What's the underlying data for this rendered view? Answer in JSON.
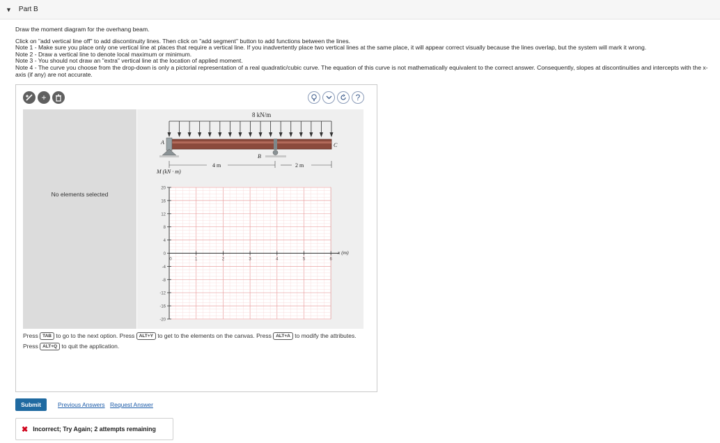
{
  "part": {
    "caret": "▼",
    "title": "Part B"
  },
  "instructions": {
    "intro": "Draw the moment diagram for the overhang beam.",
    "lines": [
      "Click on \"add vertical line off\" to add discontinuity lines. Then click on \"add segment\" button to add functions between the lines.",
      "Note 1 - Make sure you place only one vertical line at places that require a vertical line. If you inadvertently place two vertical lines at the same place, it will appear correct visually because the lines overlap, but the system will mark it wrong.",
      "Note 2 - Draw a vertical line to denote local maximum or minimum.",
      "Note 3 - You should not draw an \"extra\" vertical line at the location of applied moment.",
      "Note 4 - The curve you choose from the drop-down is only a pictorial representation of a real quadratic/cubic curve. The equation of this curve is not mathematically equivalent to the correct answer. Consequently, slopes at discontinuities and intercepts with the x-axis (if any) are not accurate."
    ]
  },
  "toolbar": {
    "left": [
      {
        "name": "add-vertical-line-icon",
        "glyph": "⁺∕"
      },
      {
        "name": "add-segment-icon",
        "glyph": "+"
      },
      {
        "name": "trash-icon",
        "glyph": "🗑"
      }
    ],
    "right": [
      {
        "name": "hint-bulb-icon",
        "glyph": "💡"
      },
      {
        "name": "chevron-down-icon",
        "glyph": "⌄"
      },
      {
        "name": "reset-icon",
        "glyph": "↻"
      },
      {
        "name": "help-icon",
        "glyph": "?"
      }
    ]
  },
  "side_panel": {
    "message": "No elements selected"
  },
  "figure": {
    "load_label": "8 kN/m",
    "support_a": "A",
    "support_b": "B",
    "end_c": "C",
    "span_ab": "4 m",
    "span_bc": "2 m",
    "y_axis_label": "M (kN · m)",
    "x_axis_label": "x (m)",
    "y_ticks": [
      "20",
      "16",
      "12",
      "8",
      "4",
      "0",
      "-4",
      "-8",
      "-12",
      "-16",
      "-20"
    ],
    "x_ticks": [
      "0",
      "1",
      "2",
      "3",
      "4",
      "5",
      "6"
    ]
  },
  "help": {
    "t1": "Press",
    "k1": "TAB",
    "t2": "to go to the next option. Press",
    "k2": "ALT+Y",
    "t3": "to get to the elements on the canvas. Press",
    "k3": "ALT+A",
    "t4": "to modify the attributes. Press",
    "k4": "ALT+Q",
    "t5": "to quit the application."
  },
  "actions": {
    "submit": "Submit",
    "previous_answers": "Previous Answers",
    "request_answer": "Request Answer"
  },
  "feedback": {
    "icon": "✖",
    "text": "Incorrect; Try Again; 2 attempts remaining"
  },
  "colors": {
    "accent": "#1f6aa1",
    "grid": "#f2b8b8",
    "beam": "#8b4a3c",
    "error": "#d0021b"
  }
}
